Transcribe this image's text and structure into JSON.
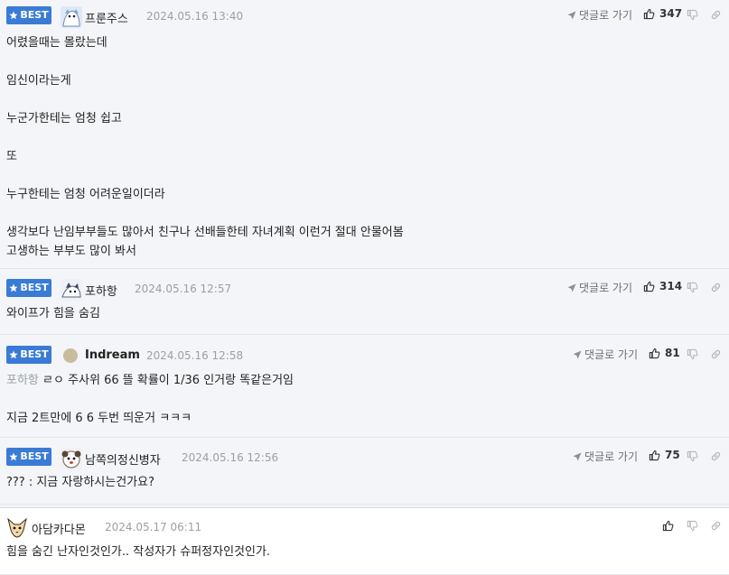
{
  "ui": {
    "best_label": "BEST",
    "reply_label": "댓글로 가기"
  },
  "comments": [
    {
      "nickname": "프룬주스",
      "date": "2024.05.16 13:40",
      "likes": "347",
      "text": "어렸을때는 몰랐는데\n\n임신이라는게\n\n누군가한테는 엄청 쉽고\n\n또\n\n누구한테는 엄청 어려운일이더라\n\n생각보다 난임부부들도 많아서 친구나 선배들한테 자녀계획 이런거 절대 안물어봄\n고생하는 부부도 많이 봐서"
    },
    {
      "nickname": "포하항",
      "date": "2024.05.16 12:57",
      "likes": "314",
      "text": "와이프가 힘을 숨김"
    },
    {
      "nickname": "Indream",
      "date": "2024.05.16 12:58",
      "likes": "81",
      "mention": "포하항",
      "text": " ㄹㅇ 주사위 66 뜰 확률이 1/36 인거랑 똑같은거임\n\n지금 2트만에 6 6 두번 띄운거 ㅋㅋㅋ"
    },
    {
      "nickname": "남쪽의정신병자",
      "date": "2024.05.16 12:56",
      "likes": "75",
      "text": "??? : 지금 자랑하시는건가요?"
    },
    {
      "nickname": "아담카다몬",
      "date": "2024.05.17 06:11",
      "text": "힘을 숨긴 난자인것인가.. 작성자가 슈퍼정자인것인가."
    }
  ]
}
